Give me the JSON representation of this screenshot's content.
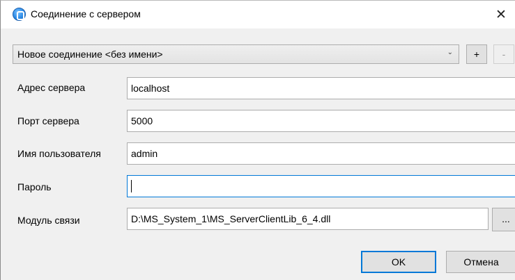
{
  "window": {
    "title": "Соединение с сервером",
    "close_glyph": "✕",
    "icon": "app-connection-icon"
  },
  "connection": {
    "selected": "Новое соединение <без имени>",
    "dropdown_arrow": "⌄",
    "add_label": "+",
    "remove_label": "-"
  },
  "form": {
    "server_address": {
      "label": "Адрес сервера",
      "value": "localhost"
    },
    "server_port": {
      "label": "Порт сервера",
      "value": "5000"
    },
    "username": {
      "label": "Имя пользователя",
      "value": "admin"
    },
    "password": {
      "label": "Пароль",
      "value": ""
    },
    "comm_module": {
      "label": "Модуль связи",
      "value": "D:\\MS_System_1\\MS_ServerClientLib_6_4.dll",
      "browse_label": "..."
    }
  },
  "buttons": {
    "ok": "OK",
    "cancel": "Отмена"
  },
  "colors": {
    "focus_accent": "#0078d7",
    "dialog_bg": "#f0f0f0"
  }
}
